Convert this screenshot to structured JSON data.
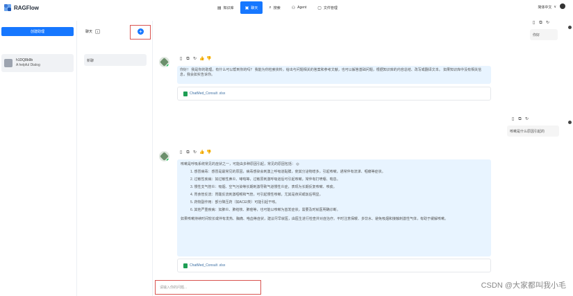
{
  "app": {
    "logo_text": "RAGFlow"
  },
  "nav": {
    "tabs": [
      {
        "label": "知识库",
        "icon": "database-icon",
        "glyph": "▤"
      },
      {
        "label": "聊天",
        "icon": "chat-icon",
        "glyph": "▣"
      },
      {
        "label": "搜索",
        "icon": "search-icon",
        "glyph": "⌕"
      },
      {
        "label": "Agent",
        "icon": "agent-icon",
        "glyph": "⚇"
      },
      {
        "label": "文件管理",
        "icon": "file-icon",
        "glyph": "▢"
      }
    ],
    "language": "简体中文",
    "language_caret": "∨",
    "accent": "#1677ff"
  },
  "assistants": {
    "new_chat_label": "创建助理",
    "items": [
      {
        "name": "h1DQ8b9b",
        "desc": "A helpful Dialog"
      }
    ]
  },
  "conversations": {
    "header_label": "聊天",
    "count": "1",
    "add_symbol": "+",
    "items": [
      {
        "label": "新聊"
      }
    ]
  },
  "chat": {
    "top_right_label": "你好",
    "tool_glyphs": [
      "▯",
      "⧉",
      "↻",
      "👍",
      "👎"
    ],
    "user_tool_glyphs": [
      "▯",
      "⧉",
      "↻"
    ],
    "message1": {
      "text": "你好！ 我是你的助理，有什么可以帮到你的吗？ 我能为你检索资料，给出与问题相关的答案和参考文献，也可以解答基础问题，根据知识库的内容总结、改写或翻译文本。 如果知识库中没有相关信息，我会如实告诉你。",
      "doc_label": "ChatMed_Consult .xlsx"
    },
    "user_message": "咳嗽是什么原因引起的",
    "message2": {
      "intro": "咳嗽是呼吸系统常见的症状之一，可能由多种原因引起，常见的原因包括：",
      "intro_icon": "◎",
      "items": [
        "1. 感冒病毒：感冒是最常见的原因，病毒感染会刺激上呼吸道黏膜，使其分泌物增多，引起咳嗽，通常伴有流涕、咽痛等症状。",
        "2. 过敏性疾病：如过敏性鼻炎、哮喘等，过敏原刺激呼吸道后可引起咳嗽，常伴有打喷嚏、喘息。",
        "3. 慢性支气管炎：吸烟、空气污染等长期刺激导致气道慢性炎症，表现为长期反复咳嗽、咳痰。",
        "4. 胃食管反流：胃酸反流刺激咽喉和气管，可引起慢性咳嗽，尤其是夜间或饭后明显。",
        "5. 药物副作用：部分降压药（如ACEI类）可能引起干咳。",
        "6. 其他严重疾病：如肺炎、肺结核、肺癌等，也可能以咳嗽为首发症状，需要及时就医明确诊断。"
      ],
      "outro": "如果咳嗽持续时间较长或伴有发热、胸痛、咯血等症状，建议尽早就医，由医生进行检查并对症治疗。平时注意保暖、多饮水、避免吸烟和接触刺激性气体，有助于缓解咳嗽。",
      "doc_label": "ChatMed_Consult .xlsx"
    },
    "input_placeholder": "请输入你的问题..."
  },
  "watermark": "CSDN @大家都叫我小毛"
}
